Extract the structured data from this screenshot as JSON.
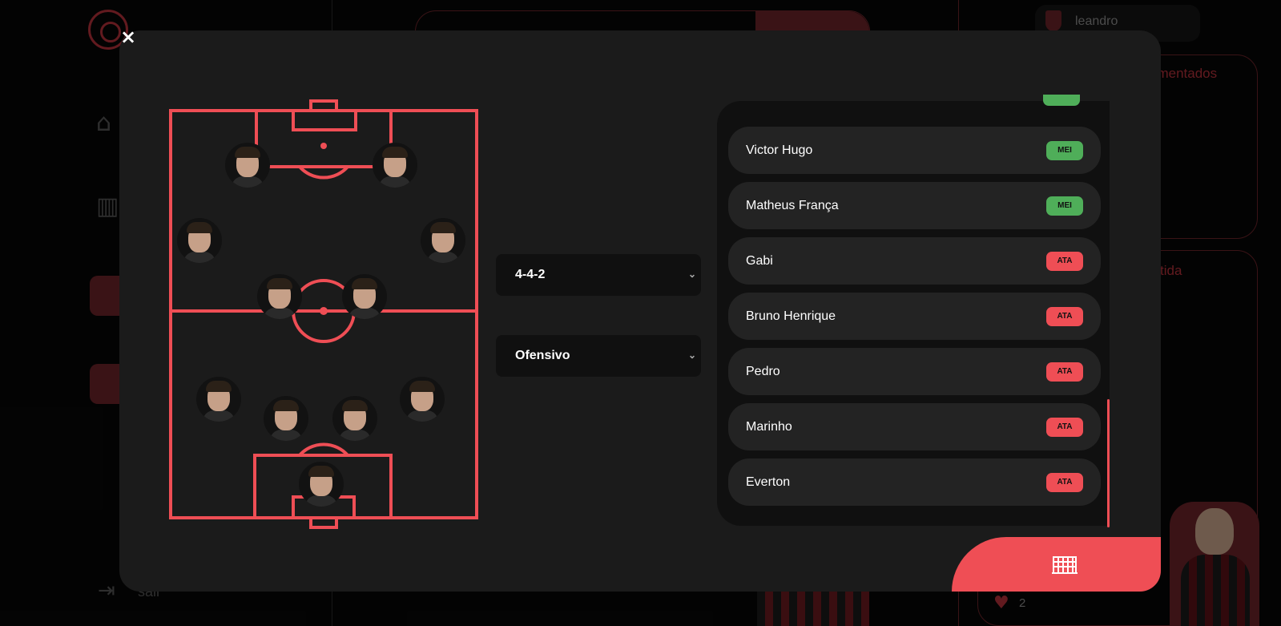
{
  "background": {
    "user_name": "leandro",
    "section_comentados": "omentados",
    "section_partida": "tida",
    "like_count": "2",
    "sair_label": "sair"
  },
  "modal": {
    "close_label": "×",
    "formation": {
      "selected": "4-4-2"
    },
    "style": {
      "selected": "Ofensivo"
    },
    "players": [
      {
        "name": "Victor Hugo",
        "position": "MEI"
      },
      {
        "name": "Matheus França",
        "position": "MEI"
      },
      {
        "name": "Gabi",
        "position": "ATA"
      },
      {
        "name": "Bruno Henrique",
        "position": "ATA"
      },
      {
        "name": "Pedro",
        "position": "ATA"
      },
      {
        "name": "Marinho",
        "position": "ATA"
      },
      {
        "name": "Everton",
        "position": "ATA"
      }
    ],
    "save_icon": "goal-net-icon"
  },
  "colors": {
    "accent": "#ef4e55",
    "mei": "#4fae59",
    "ata": "#ef4e55",
    "panel": "#1b1b1b"
  }
}
